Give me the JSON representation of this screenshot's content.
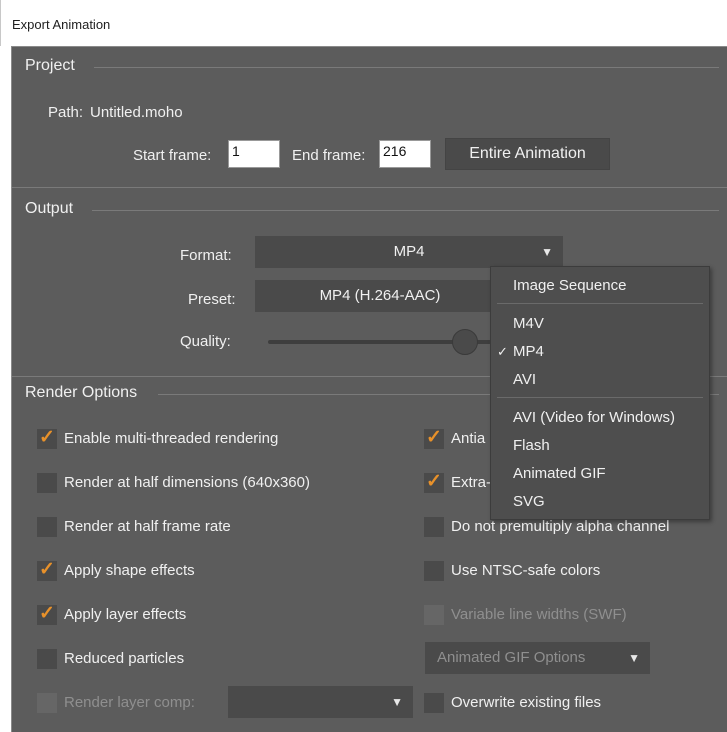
{
  "window": {
    "title": "Export Animation"
  },
  "project": {
    "title": "Project",
    "path_label": "Path:",
    "path_value": "Untitled.moho",
    "start_label": "Start frame:",
    "start_value": "1",
    "end_label": "End frame:",
    "end_value": "216",
    "entire_button": "Entire Animation"
  },
  "output": {
    "title": "Output",
    "format_label": "Format:",
    "format_value": "MP4",
    "preset_label": "Preset:",
    "preset_value": "MP4 (H.264-AAC)",
    "quality_label": "Quality:"
  },
  "format_menu": {
    "items": [
      {
        "label": "Image Sequence",
        "checked": false
      },
      {
        "label": "M4V",
        "checked": false
      },
      {
        "label": "MP4",
        "checked": true
      },
      {
        "label": "AVI",
        "checked": false
      },
      {
        "label": "AVI (Video for Windows)",
        "checked": false
      },
      {
        "label": "Flash",
        "checked": false
      },
      {
        "label": "Animated GIF",
        "checked": false
      },
      {
        "label": "SVG",
        "checked": false
      }
    ],
    "check_glyph": "✓"
  },
  "render_options": {
    "title": "Render Options",
    "left": [
      {
        "label": "Enable multi-threaded rendering",
        "checked": true,
        "enabled": true
      },
      {
        "label": "Render at half dimensions (640x360)",
        "checked": false,
        "enabled": true
      },
      {
        "label": "Render at half frame rate",
        "checked": false,
        "enabled": true
      },
      {
        "label": "Apply shape effects",
        "checked": true,
        "enabled": true
      },
      {
        "label": "Apply layer effects",
        "checked": true,
        "enabled": true
      },
      {
        "label": "Reduced particles",
        "checked": false,
        "enabled": true
      },
      {
        "label": "Render layer comp:",
        "checked": false,
        "enabled": false
      }
    ],
    "right": [
      {
        "label": "Antia",
        "checked": true,
        "enabled": true
      },
      {
        "label": "Extra-",
        "checked": true,
        "enabled": true
      },
      {
        "label": "Do not premultiply alpha channel",
        "checked": false,
        "enabled": true
      },
      {
        "label": "Use NTSC-safe colors",
        "checked": false,
        "enabled": true
      },
      {
        "label": "Variable line widths (SWF)",
        "checked": false,
        "enabled": false
      },
      {
        "label": "Overwrite existing files",
        "checked": false,
        "enabled": true
      }
    ],
    "gif_options_button": "Animated GIF Options",
    "layer_comp_value": ""
  },
  "icons": {
    "dropdown": "▼",
    "check": "✓"
  },
  "colors": {
    "panel": "#5c5c5c",
    "control": "#4a4a4a",
    "accent": "#e8912a"
  }
}
